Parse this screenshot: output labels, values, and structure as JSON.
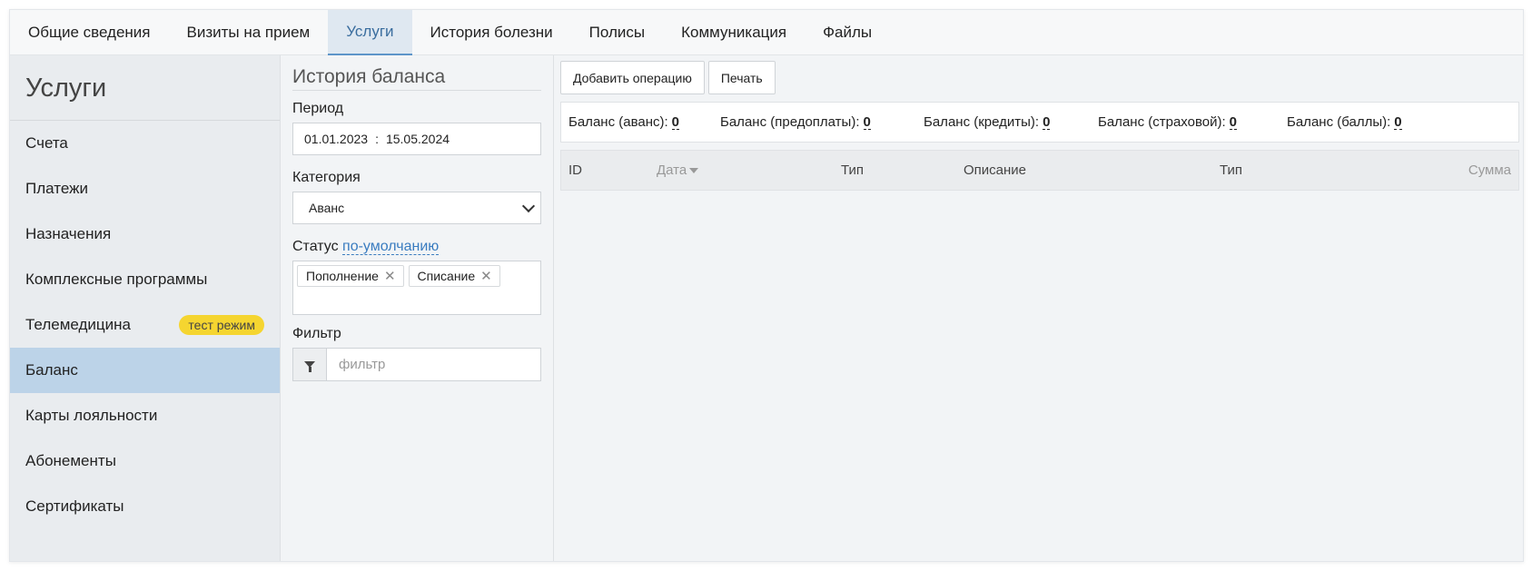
{
  "tabs": [
    {
      "label": "Общие сведения"
    },
    {
      "label": "Визиты на прием"
    },
    {
      "label": "Услуги"
    },
    {
      "label": "История болезни"
    },
    {
      "label": "Полисы"
    },
    {
      "label": "Коммуникация"
    },
    {
      "label": "Файлы"
    }
  ],
  "active_tab": "Услуги",
  "sidebar": {
    "title": "Услуги",
    "items": [
      {
        "label": "Счета"
      },
      {
        "label": "Платежи"
      },
      {
        "label": "Назначения"
      },
      {
        "label": "Комплексные программы"
      },
      {
        "label": "Телемедицина",
        "badge": "тест режим"
      },
      {
        "label": "Баланс"
      },
      {
        "label": "Карты лояльности"
      },
      {
        "label": "Абонементы"
      },
      {
        "label": "Сертификаты"
      }
    ],
    "active_item": "Баланс"
  },
  "filters": {
    "title": "История баланса",
    "period_label": "Период",
    "period_from": "01.01.2023",
    "period_separator": ":",
    "period_to": "15.05.2024",
    "category_label": "Категория",
    "category_value": "Аванс",
    "status_label": "Статус",
    "status_link": "по-умолчанию",
    "status_chips": [
      "Пополнение",
      "Списание"
    ],
    "filter_label": "Фильтр",
    "filter_placeholder": "фильтр"
  },
  "toolbar": {
    "add_label": "Добавить операцию",
    "print_label": "Печать"
  },
  "balances": [
    {
      "label": "Баланс (аванс):",
      "value": "0"
    },
    {
      "label": "Баланс (предоплаты):",
      "value": "0"
    },
    {
      "label": "Баланс (кредиты):",
      "value": "0"
    },
    {
      "label": "Баланс (страховой):",
      "value": "0"
    },
    {
      "label": "Баланс (баллы):",
      "value": "0"
    }
  ],
  "table": {
    "columns": [
      "ID",
      "Дата",
      "Тип",
      "Описание",
      "Тип",
      "Сумма"
    ],
    "sort_column": "Дата"
  },
  "colors": {
    "active_tab_bg": "#dfe8f1",
    "active_sidebar_bg": "#bcd3e8",
    "badge_bg": "#f5d530",
    "link": "#3a7cc0"
  }
}
